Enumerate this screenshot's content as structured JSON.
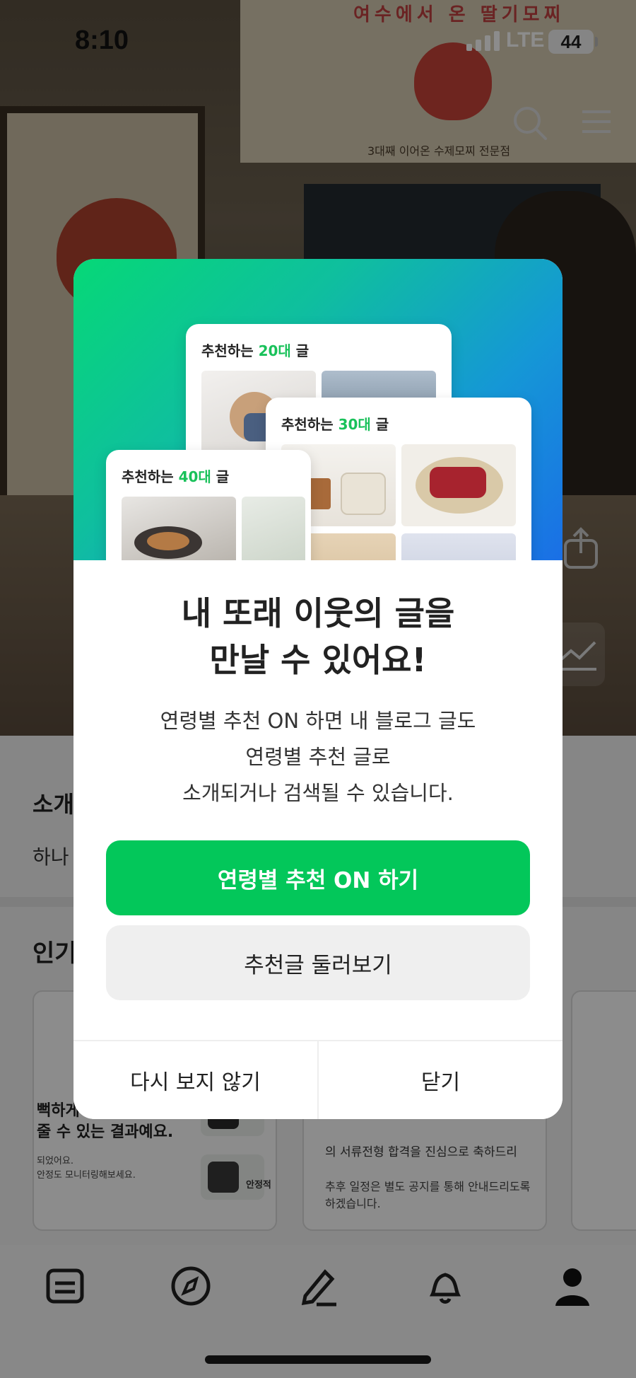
{
  "status_bar": {
    "time": "8:10",
    "network": "LTE",
    "battery": "44"
  },
  "background": {
    "poster_text": "여수에서  온  딸기모찌",
    "poster_caption": "3대째 이어온 수제모찌 전문점",
    "intro_title": "소개",
    "intro_text": "하나",
    "popular_title": "인기",
    "card1": {
      "line1": "뻑하게",
      "line2": "줄 수 있는 결과예요.",
      "small1": "되었어요.",
      "small2": "안정도 모니터링해보세요.",
      "tile_label": "안정적"
    },
    "card2": {
      "title": "의 서류전형 합격을 진심으로 축하드리",
      "text": "추후 일정은 별도 공지를 통해 안내드리도록 하겠습니다."
    }
  },
  "modal": {
    "cards": [
      {
        "prefix": "추천하는 ",
        "age": "20대",
        "suffix": " 글"
      },
      {
        "prefix": "추천하는 ",
        "age": "30대",
        "suffix": " 글"
      },
      {
        "prefix": "추천하는 ",
        "age": "40대",
        "suffix": " 글"
      }
    ],
    "headline_line1": "내 또래 이웃의 글을",
    "headline_line2": "만날 수 있어요!",
    "desc_line1": "연령별 추천 ON 하면 내 블로그 글도",
    "desc_line2": "연령별 추천 글로",
    "desc_line3": "소개되거나 검색될 수 있습니다.",
    "primary_button": "연령별 추천 ON 하기",
    "secondary_button": "추천글 둘러보기",
    "footer_left": "다시 보지 않기",
    "footer_right": "닫기"
  },
  "colors": {
    "accent_green": "#03c75a",
    "age_green": "#19c15a",
    "banner_blue": "#1a6fe6"
  },
  "icons": {
    "top": [
      "search-icon",
      "menu-icon"
    ],
    "tabs": [
      "feed-icon",
      "compass-icon",
      "pencil-icon",
      "bell-icon",
      "profile-icon"
    ]
  }
}
